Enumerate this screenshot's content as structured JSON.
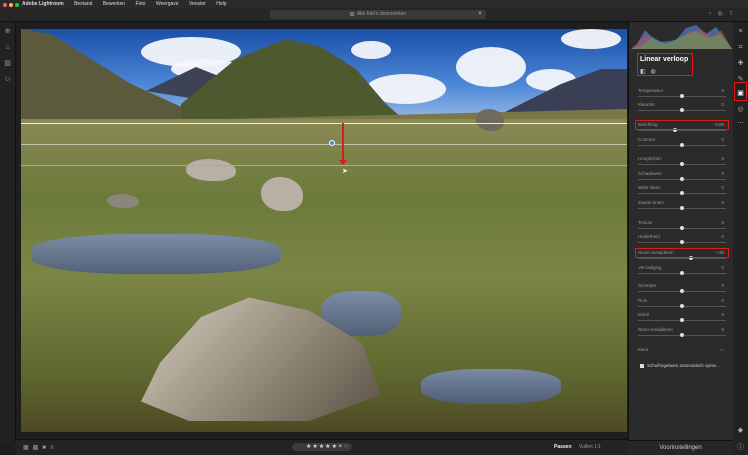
{
  "menubar": {
    "app": "Adobe Lightroom",
    "items": [
      "Bestand",
      "Bewerken",
      "Foto",
      "Weergave",
      "Venster",
      "Help"
    ],
    "light_colors": [
      "#ff5f57",
      "#febc2e",
      "#28c840"
    ]
  },
  "search": {
    "placeholder": "Alle foto's doorzoeken"
  },
  "panel": {
    "title": "Linear verloop",
    "sliders": [
      {
        "label": "Temperatuur",
        "value": "0",
        "level": 0.5
      },
      {
        "label": "Kleurtint",
        "value": "0",
        "level": 0.5
      },
      {
        "label": "Belichting",
        "value": "-0,90",
        "level": 0.42,
        "highlight": true
      },
      {
        "label": "Contrast",
        "value": "0",
        "level": 0.5
      },
      {
        "label": "Hooglichten",
        "value": "0",
        "level": 0.5
      },
      {
        "label": "Schaduwen",
        "value": "0",
        "level": 0.5
      },
      {
        "label": "Witte tinten",
        "value": "0",
        "level": 0.5
      },
      {
        "label": "Zwarte tinten",
        "value": "0",
        "level": 0.5
      },
      {
        "label": "Textuur",
        "value": "0",
        "level": 0.5
      },
      {
        "label": "Helderheid",
        "value": "0",
        "level": 0.5
      },
      {
        "label": "Nevel verwijderen",
        "value": "+30",
        "level": 0.6,
        "highlight": true
      },
      {
        "label": "Verzadiging",
        "value": "0",
        "level": 0.5
      },
      {
        "label": "Scherpte",
        "value": "0",
        "level": 0.5
      },
      {
        "label": "Ruis",
        "value": "0",
        "level": 0.5
      },
      {
        "label": "Moiré",
        "value": "0",
        "level": 0.5
      },
      {
        "label": "Rand verwijderen",
        "value": "0",
        "level": 0.5
      }
    ],
    "color_label": "Kleur",
    "checkbox_label": "Schuifregelaars automatisch opnie..."
  },
  "filmbar": {
    "stars": "★★★★★",
    "fit_label": "Passen",
    "fill_label": "Vullen",
    "ratio_label": "1:1"
  },
  "presets_label": "Voorinstellingen",
  "accent_colors": {
    "highlight": "#e01919",
    "pin": "#3d8ee8",
    "gradient_line": "#7fd04f"
  }
}
